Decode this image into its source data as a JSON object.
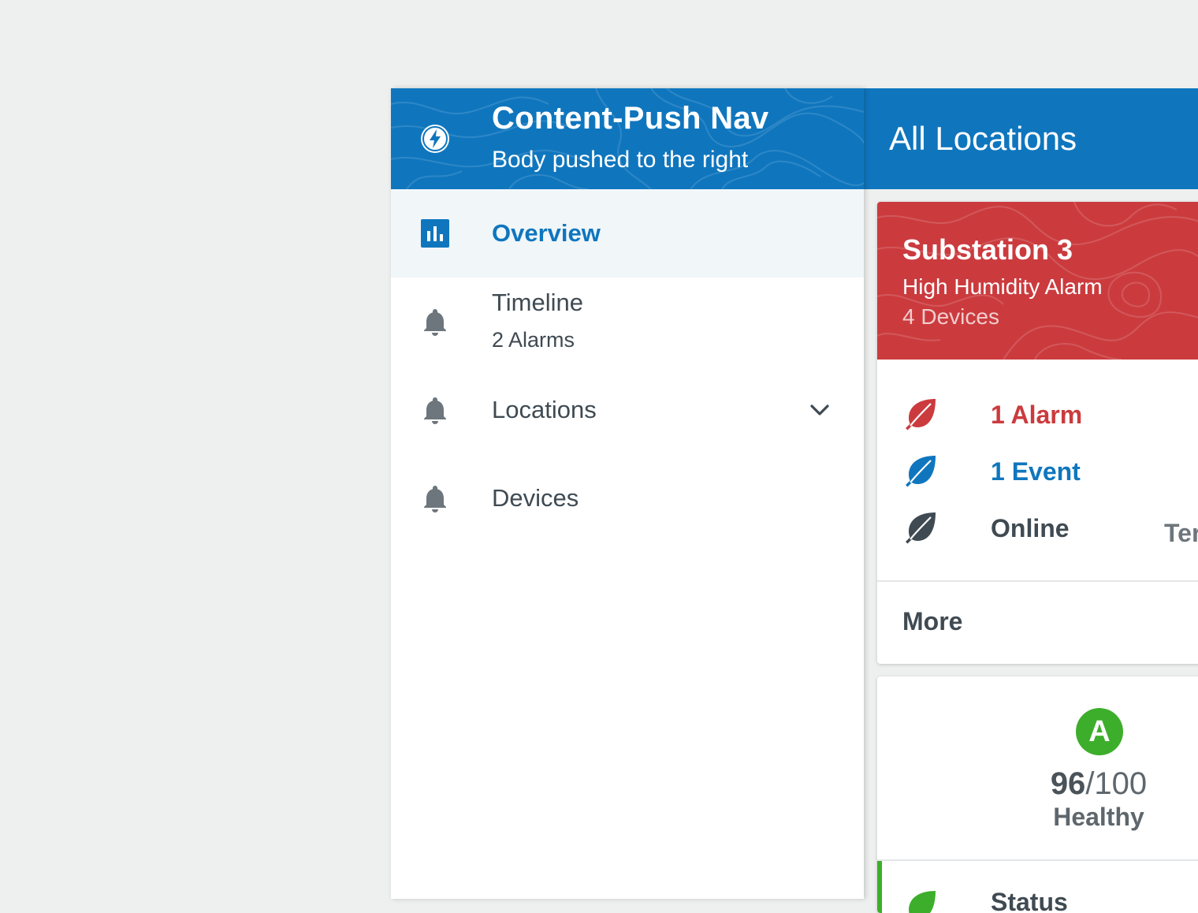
{
  "drawer": {
    "title": "Content-Push Nav",
    "subtitle": "Body pushed to the right",
    "app_icon": "bolt-icon",
    "items": [
      {
        "label": "Overview",
        "icon": "bar-chart-icon",
        "active": true
      },
      {
        "label": "Timeline",
        "sublabel": "2 Alarms",
        "icon": "bell-icon"
      },
      {
        "label": "Locations",
        "icon": "bell-icon",
        "expandable": true
      },
      {
        "label": "Devices",
        "icon": "bell-icon"
      }
    ]
  },
  "appbar": {
    "title": "All Locations"
  },
  "card1": {
    "title": "Substation 3",
    "subtitle": "High Humidity Alarm",
    "devices": "4 Devices",
    "stats": [
      {
        "label": "1 Alarm",
        "color": "#cb3b3e",
        "icon": "leaf-icon"
      },
      {
        "label": "1 Event",
        "color": "#0f76be",
        "icon": "leaf-icon"
      },
      {
        "label": "Online",
        "color": "#3f4a52",
        "icon": "leaf-icon",
        "extra": "Ter"
      }
    ],
    "more": "More"
  },
  "card2": {
    "grade": "A",
    "score": "96",
    "score_total": "/100",
    "health": "Healthy",
    "status_label": "Status"
  },
  "colors": {
    "primary": "#0f76be",
    "alarm": "#cb3b3e",
    "healthy": "#3dae2b",
    "text": "#3f4a52",
    "nav_active_bg": "#f1f6f9"
  }
}
